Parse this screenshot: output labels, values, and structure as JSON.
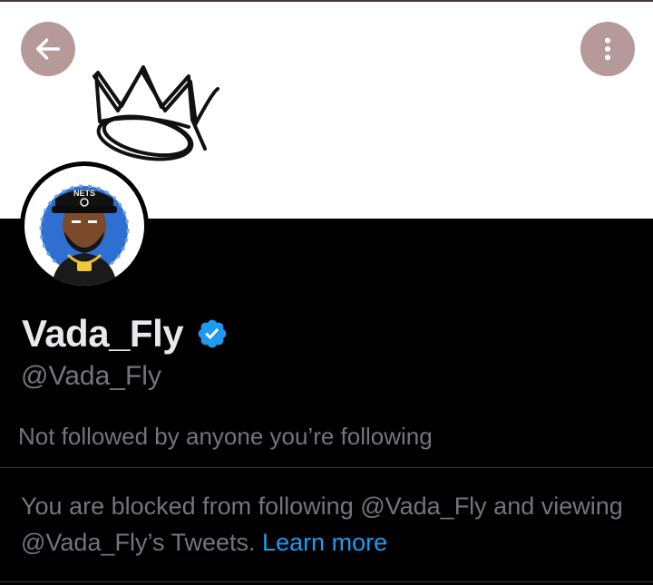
{
  "profile": {
    "display_name": "Vada_Fly",
    "handle": "@Vada_Fly",
    "verified": true,
    "followed_by_text": "Not followed by anyone you’re following",
    "avatar_cap_text": "NETS"
  },
  "blocked": {
    "message": "You are blocked from following @Vada_Fly and viewing @Vada_Fly’s Tweets. ",
    "link_label": "Learn more"
  },
  "icons": {
    "back": "arrow-left-icon",
    "more": "more-vertical-icon",
    "verified": "verified-badge-icon",
    "banner": "crown-icon"
  },
  "colors": {
    "background": "#000000",
    "banner": "#ffffff",
    "header_buttons": "#b69a9a",
    "display_name": "#e7e9ea",
    "secondary_text": "#71767b",
    "link": "#1d9bf0",
    "verified": "#1d9bf0"
  }
}
